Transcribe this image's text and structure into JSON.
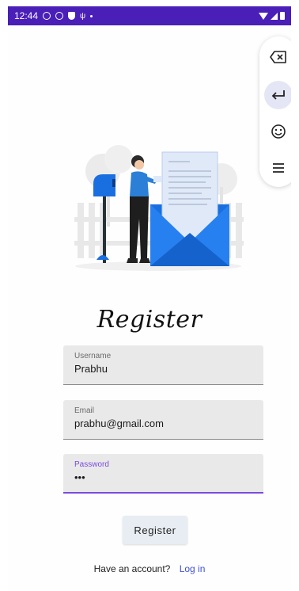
{
  "status_bar": {
    "time": "12:44",
    "icons": [
      "alarm-icon",
      "do-not-disturb-icon",
      "shield-icon",
      "usb-icon",
      "dot-icon",
      "wifi-icon",
      "signal-icon",
      "battery-icon"
    ]
  },
  "keyboard_toolbar": {
    "buttons": [
      "backspace-icon",
      "enter-icon",
      "emoji-icon",
      "menu-icon"
    ]
  },
  "title": "Register",
  "form": {
    "username": {
      "label": "Username",
      "value": "Prabhu"
    },
    "email": {
      "label": "Email",
      "value": "prabhu@gmail.com"
    },
    "password": {
      "label": "Password",
      "value": "•••"
    }
  },
  "register_button": "Register",
  "footer": {
    "text": "Have an account?",
    "link": "Log in"
  },
  "colors": {
    "status_bar": "#4a1fb8",
    "accent": "#7b4be0",
    "link": "#3f51d6",
    "envelope": "#1a6fe0"
  }
}
